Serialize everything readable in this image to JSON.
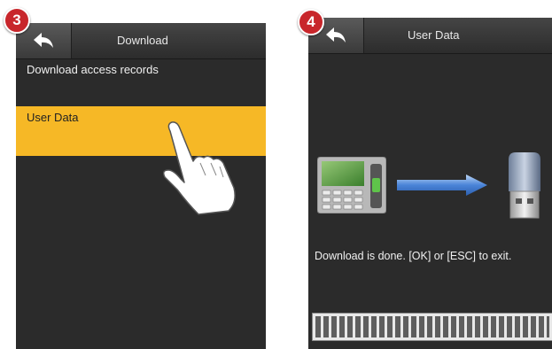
{
  "step3": {
    "badge": "3",
    "title": "Download",
    "menu": [
      {
        "label": "Download access records"
      },
      {
        "label": "User Data"
      }
    ],
    "selected_index": 1
  },
  "step4": {
    "badge": "4",
    "title": "User Data",
    "message": "Download is done. [OK] or [ESC] to exit.",
    "progress": 1.0
  },
  "icons": {
    "back": "back-arrow-icon",
    "hand": "pointing-hand-icon",
    "device": "terminal-device-icon",
    "arrow": "transfer-arrow-icon",
    "usb": "usb-drive-icon"
  },
  "colors": {
    "screen_bg": "#2b2b2b",
    "highlight": "#f6b826",
    "badge": "#c8262b"
  }
}
